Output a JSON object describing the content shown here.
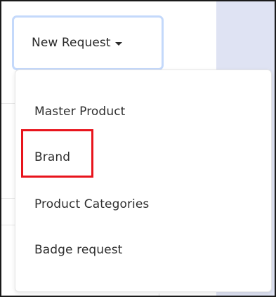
{
  "toolbar": {
    "new_request_label": "New Request"
  },
  "menu": {
    "items": [
      {
        "label": "Master Product"
      },
      {
        "label": "Brand",
        "highlighted": true
      },
      {
        "label": "Product Categories"
      },
      {
        "label": "Badge request"
      }
    ]
  },
  "colors": {
    "highlight": "#e8141c",
    "focus_ring": "#c4d9fb",
    "side_panel": "#dfe3f3"
  },
  "icons": {
    "dropdown_caret": "caret-down-icon"
  }
}
